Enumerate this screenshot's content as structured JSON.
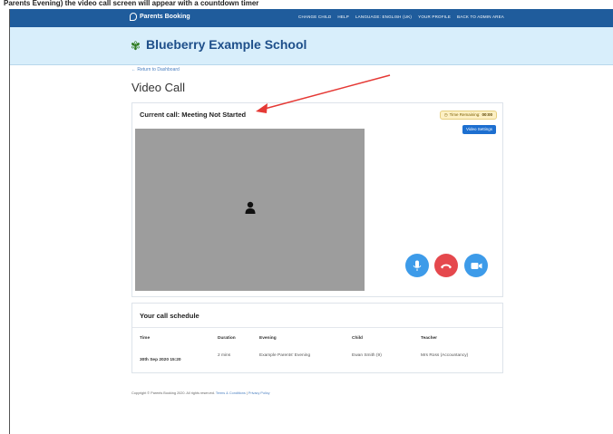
{
  "caption": "Parents Evening) the video call screen will appear with a countdown timer",
  "header": {
    "brand": "Parents Booking",
    "nav": [
      "CHANGE CHILD",
      "HELP",
      "LANGUAGE: ENGLISH (UK)",
      "YOUR PROFILE",
      "BACK TO ADMIN AREA"
    ]
  },
  "school": {
    "name": "Blueberry Example School"
  },
  "page": {
    "back_link": "← Return to Dashboard",
    "title": "Video Call"
  },
  "call": {
    "title": "Current call: Meeting Not Started",
    "time_remaining_label": "Time Remaining:",
    "time_remaining_value": "00:00",
    "settings_button": "Video Settings"
  },
  "schedule": {
    "title": "Your call schedule",
    "columns": [
      "Time",
      "Duration",
      "Evening",
      "Child",
      "Teacher"
    ],
    "rows": [
      {
        "time": "30th Sep 2020 15:20",
        "duration": "2 mins",
        "evening": "Example Parents' Evening",
        "child": "Ewan Smith (9)",
        "teacher": "Mrs Ross (Accountancy)"
      }
    ]
  },
  "footer": {
    "copyright": "Copyright © Parents Booking 2020. All rights reserved.",
    "terms": "Terms & Conditions",
    "privacy": "Privacy Policy"
  },
  "icons": {
    "person": "person-icon",
    "mic": "microphone-icon",
    "hangup": "hang-up-icon",
    "camera": "camera-icon"
  },
  "colors": {
    "topbar": "#1f5c9c",
    "banner": "#d8eefb",
    "primary_button": "#1d6fd0",
    "control_blue": "#3d9be9",
    "hangup_red": "#e5484d",
    "annotation_arrow": "#e53935"
  }
}
